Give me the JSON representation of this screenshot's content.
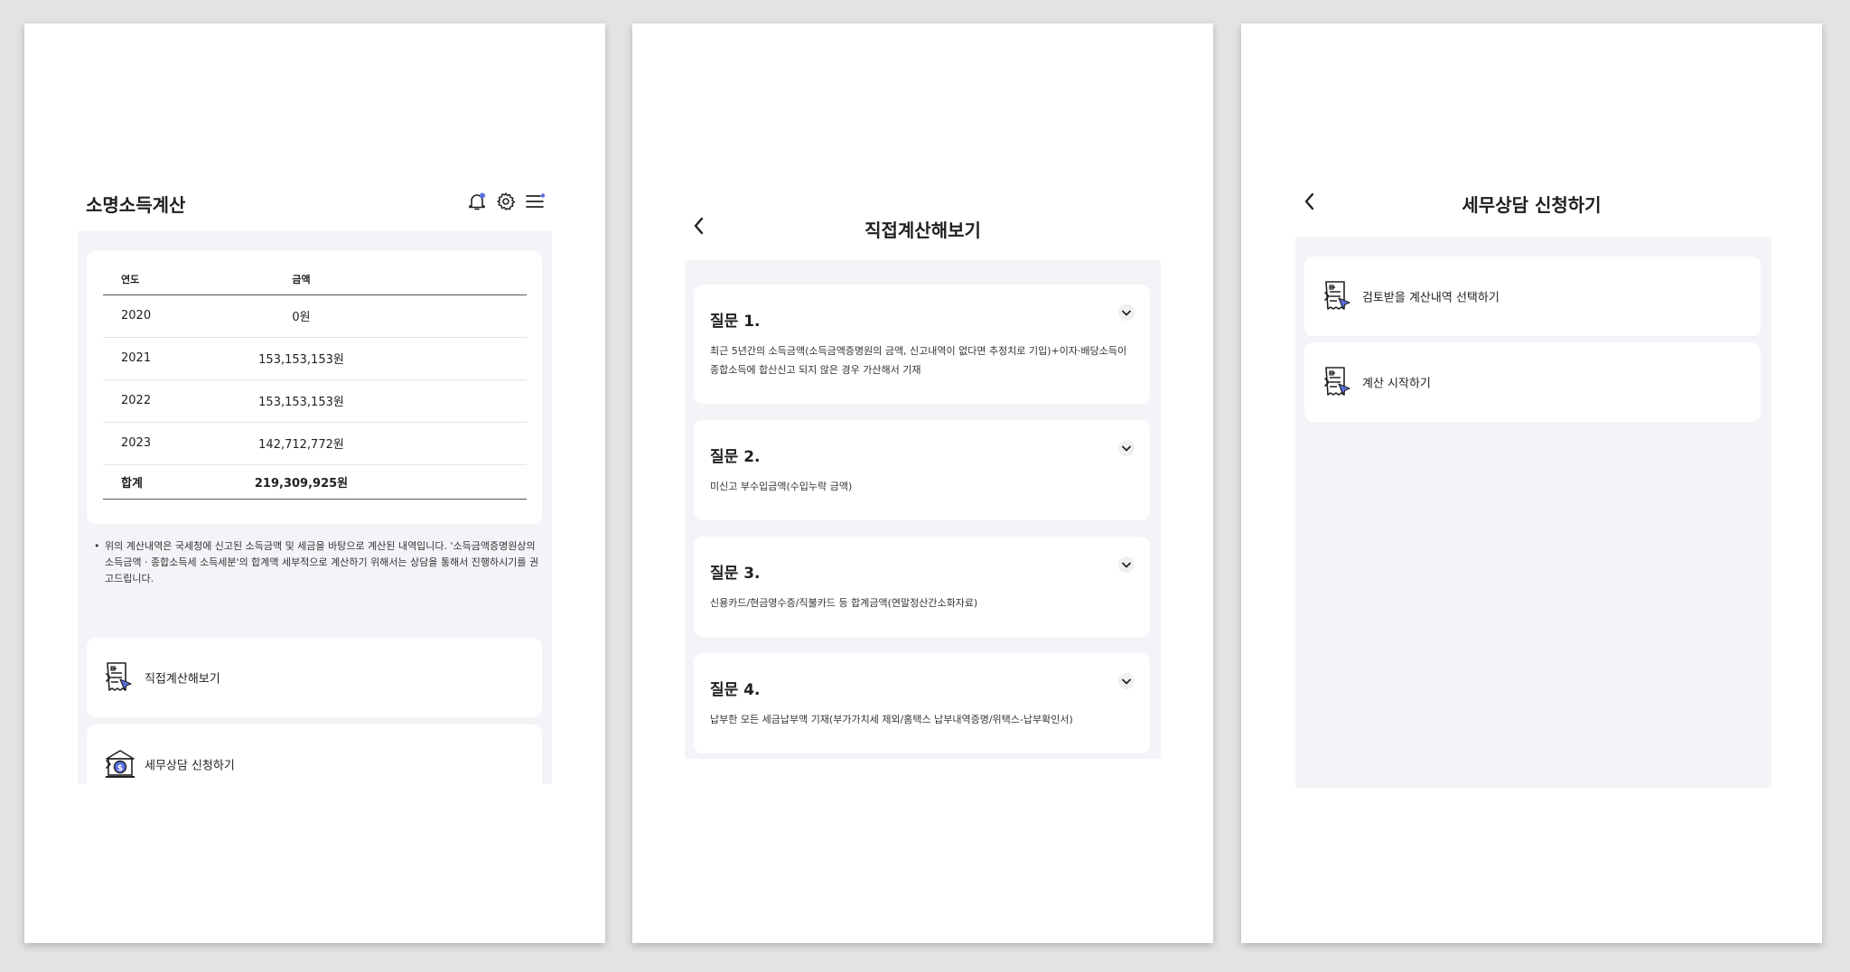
{
  "screen1": {
    "title": "소명소득계산",
    "table": {
      "headers": {
        "year": "연도",
        "amount": "금액"
      },
      "rows": [
        {
          "year": "2020",
          "amount": "0원"
        },
        {
          "year": "2021",
          "amount": "153,153,153원"
        },
        {
          "year": "2022",
          "amount": "153,153,153원"
        },
        {
          "year": "2023",
          "amount": "142,712,772원"
        }
      ],
      "total": {
        "label": "합계",
        "amount": "219,309,925원"
      }
    },
    "note": "위의 계산내역은 국세청에 신고된 소득금액 및 세금을 바탕으로 계산된 내역입니다. '소득금액증명원상의 소득금액 · 종합소득세 소득세분'의 합계액 세부적으로 계산하기 위해서는 상담을 통해서 진행하시기를 권고드립니다.",
    "menu": [
      {
        "label": "직접계산해보기",
        "icon": "receipt-cursor-icon"
      },
      {
        "label": "세무상담 신청하기",
        "icon": "bank-coin-icon"
      }
    ],
    "accent_color": "#5b6ee1"
  },
  "screen2": {
    "title": "직접계산해보기",
    "questions": [
      {
        "title": "질문 1.",
        "desc": "최근 5년간의 소득금액(소득금액증명원의 금액, 신고내역이 없다면 추정치로 기입)+이자·배당소득이 종합소득에 합산신고 되지 않은 경우 가산해서 기재"
      },
      {
        "title": "질문 2.",
        "desc": "미신고 부수입금액(수입누락 금액)"
      },
      {
        "title": "질문 3.",
        "desc": "신용카드/현금영수증/직불카드 등 합계금액(연말정산간소화자료)"
      },
      {
        "title": "질문 4.",
        "desc": "납부한 모든 세금납부액 기재(부가가치세 제외/홈택스 납부내역증명/위택스-납부확인서)"
      }
    ]
  },
  "screen3": {
    "title": "세무상담 신청하기",
    "menu": [
      {
        "label": "검토받을 계산내역 선택하기",
        "icon": "receipt-cursor-icon"
      },
      {
        "label": "계산 시작하기",
        "icon": "receipt-cursor-icon"
      }
    ]
  }
}
